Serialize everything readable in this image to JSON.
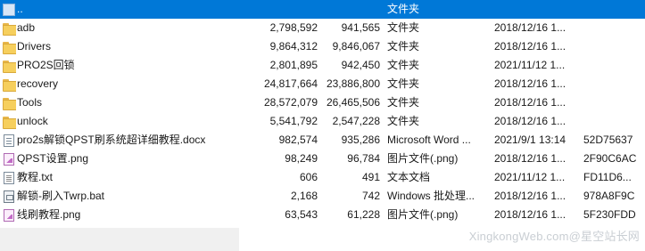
{
  "rows": [
    {
      "name": "..",
      "size": "",
      "packed": "",
      "type": "文件夹",
      "modified": "",
      "crc": "",
      "icon": "up-folder-icon",
      "selected": true
    },
    {
      "name": "adb",
      "size": "2,798,592",
      "packed": "941,565",
      "type": "文件夹",
      "modified": "2018/12/16 1...",
      "crc": "",
      "icon": "folder-icon"
    },
    {
      "name": "Drivers",
      "size": "9,864,312",
      "packed": "9,846,067",
      "type": "文件夹",
      "modified": "2018/12/16 1...",
      "crc": "",
      "icon": "folder-icon"
    },
    {
      "name": "PRO2S回锁",
      "size": "2,801,895",
      "packed": "942,450",
      "type": "文件夹",
      "modified": "2021/11/12 1...",
      "crc": "",
      "icon": "folder-icon"
    },
    {
      "name": "recovery",
      "size": "24,817,664",
      "packed": "23,886,800",
      "type": "文件夹",
      "modified": "2018/12/16 1...",
      "crc": "",
      "icon": "folder-icon"
    },
    {
      "name": "Tools",
      "size": "28,572,079",
      "packed": "26,465,506",
      "type": "文件夹",
      "modified": "2018/12/16 1...",
      "crc": "",
      "icon": "folder-icon"
    },
    {
      "name": "unlock",
      "size": "5,541,792",
      "packed": "2,547,228",
      "type": "文件夹",
      "modified": "2018/12/16 1...",
      "crc": "",
      "icon": "folder-icon"
    },
    {
      "name": "pro2s解锁QPST刷系统超详细教程.docx",
      "size": "982,574",
      "packed": "935,286",
      "type": "Microsoft Word ...",
      "modified": "2021/9/1 13:14",
      "crc": "52D75637",
      "icon": "word-doc-icon"
    },
    {
      "name": "QPST设置.png",
      "size": "98,249",
      "packed": "96,784",
      "type": "图片文件(.png)",
      "modified": "2018/12/16 1...",
      "crc": "2F90C6AC",
      "icon": "image-file-icon"
    },
    {
      "name": "教程.txt",
      "size": "606",
      "packed": "491",
      "type": "文本文档",
      "modified": "2021/11/12 1...",
      "crc": "FD11D6...",
      "icon": "text-file-icon"
    },
    {
      "name": "解锁-刷入Twrp.bat",
      "size": "2,168",
      "packed": "742",
      "type": "Windows 批处理...",
      "modified": "2018/12/16 1...",
      "crc": "978A8F9C",
      "icon": "batch-file-icon"
    },
    {
      "name": "线刷教程.png",
      "size": "63,543",
      "packed": "61,228",
      "type": "图片文件(.png)",
      "modified": "2018/12/16 1...",
      "crc": "5F230FDD",
      "icon": "image-file-icon"
    }
  ],
  "watermark": "XingkongWeb.com@星空站长网",
  "colors": {
    "selection": "#0078d7",
    "folder": "#f6cf5d",
    "left_strip": "#f0f0f0"
  }
}
